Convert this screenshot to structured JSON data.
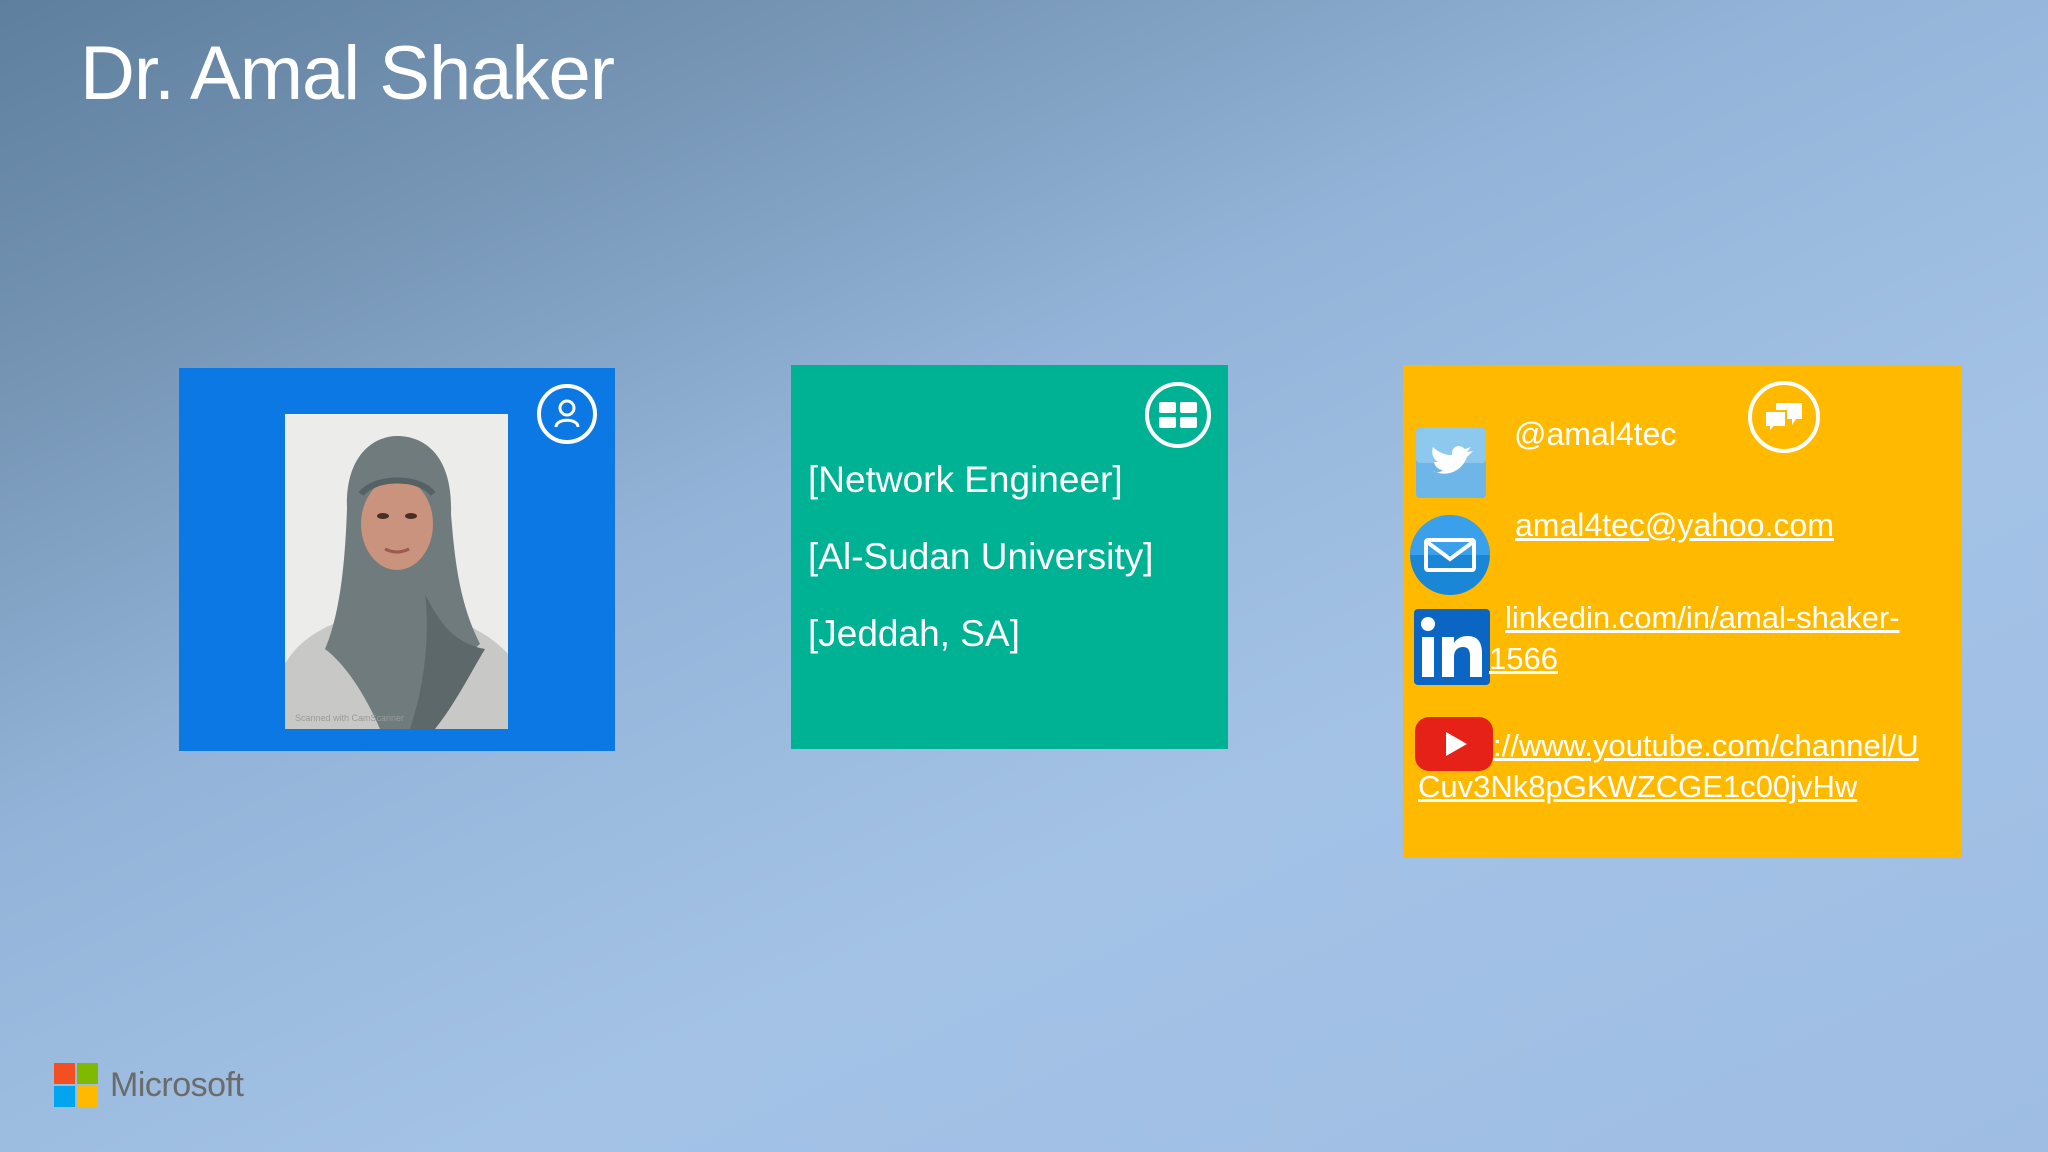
{
  "slide": {
    "title": "Dr. Amal Shaker"
  },
  "photo_tile": {
    "color": "#0b78e3",
    "icon": "person-icon",
    "scan_mark": "Scanned with CamScanner"
  },
  "info_tile": {
    "color": "#00b294",
    "icon": "grid-icon",
    "lines": [
      "[Network Engineer]",
      "[Al-Sudan University]",
      "[Jeddah, SA]"
    ]
  },
  "contact_tile": {
    "color": "#ffba00",
    "icon": "chat-icon",
    "twitter": "@amal4tec",
    "email": "amal4tec@yahoo.com",
    "linkedin_line1": "linkedin.com/in/amal-shaker-",
    "linkedin_line2": "1566",
    "youtube_line1": "://www.youtube.com/channel/U",
    "youtube_line2": "Cuv3Nk8pGKWZCGE1c00jvHw"
  },
  "branding": {
    "logo_text": "Microsoft",
    "logo_colors": [
      "#f25022",
      "#7fba00",
      "#00a4ef",
      "#ffb900"
    ]
  }
}
